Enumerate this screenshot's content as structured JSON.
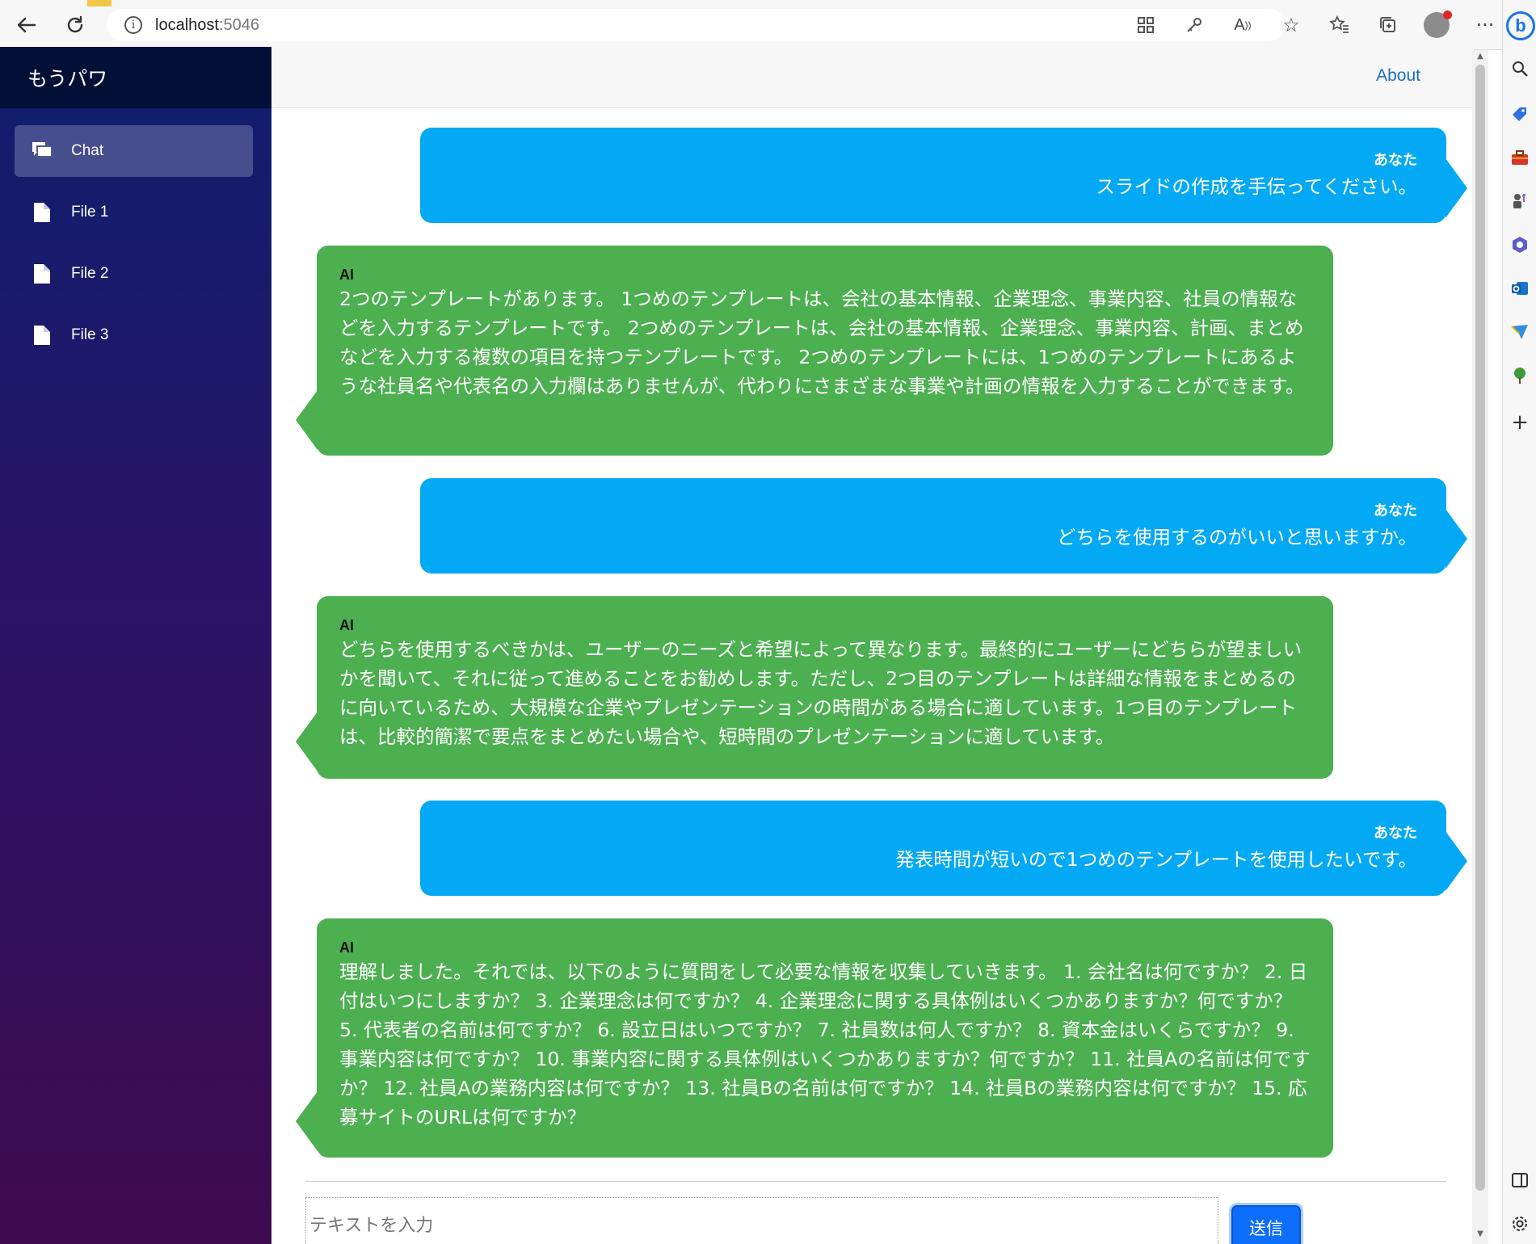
{
  "browser": {
    "url_host": "localhost",
    "url_port": ":5046"
  },
  "app": {
    "brand": "もうパワ",
    "about_label": "About"
  },
  "sidebar": {
    "items": [
      {
        "label": "Chat",
        "icon": "chat-icon",
        "active": true
      },
      {
        "label": "File 1",
        "icon": "file-icon",
        "active": false
      },
      {
        "label": "File 2",
        "icon": "file-icon",
        "active": false
      },
      {
        "label": "File 3",
        "icon": "file-icon",
        "active": false
      }
    ]
  },
  "chat": {
    "messages": [
      {
        "role": "user",
        "sender": "あなた",
        "text": "スライドの作成を手伝ってください。"
      },
      {
        "role": "ai",
        "sender": "AI",
        "text": "2つのテンプレートがあります。 1つめのテンプレートは、会社の基本情報、企業理念、事業内容、社員の情報などを入力するテンプレートです。 2つめのテンプレートは、会社の基本情報、企業理念、事業内容、計画、まとめなどを入力する複数の項目を持つテンプレートです。 2つめのテンプレートには、1つめのテンプレートにあるような社員名や代表名の入力欄はありませんが、代わりにさまざまな事業や計画の情報を入力することができます。"
      },
      {
        "role": "user",
        "sender": "あなた",
        "text": "どちらを使用するのがいいと思いますか。"
      },
      {
        "role": "ai",
        "sender": "AI",
        "text": "どちらを使用するべきかは、ユーザーのニーズと希望によって異なります。最終的にユーザーにどちらが望ましいかを聞いて、それに従って進めることをお勧めします。ただし、2つ目のテンプレートは詳細な情報をまとめるのに向いているため、大規模な企業やプレゼンテーションの時間がある場合に適しています。1つ目のテンプレートは、比較的簡潔で要点をまとめたい場合や、短時間のプレゼンテーションに適しています。"
      },
      {
        "role": "user",
        "sender": "あなた",
        "text": "発表時間が短いので1つめのテンプレートを使用したいです。"
      },
      {
        "role": "ai",
        "sender": "AI",
        "text": "理解しました。それでは、以下のように質問をして必要な情報を収集していきます。 1. 会社名は何ですか？ 2. 日付はいつにしますか？ 3. 企業理念は何ですか？ 4. 企業理念に関する具体例はいくつかありますか？何ですか？ 5. 代表者の名前は何ですか？ 6. 設立日はいつですか？ 7. 社員数は何人ですか？ 8. 資本金はいくらですか？ 9. 事業内容は何ですか？ 10. 事業内容に関する具体例はいくつかありますか？何ですか？ 11. 社員Aの名前は何ですか？ 12. 社員Aの業務内容は何ですか？ 13. 社員Bの名前は何ですか？ 14. 社員Bの業務内容は何ですか？ 15. 応募サイトのURLは何ですか？"
      }
    ]
  },
  "composer": {
    "placeholder": "テキストを入力",
    "value": "",
    "send_label": "送信"
  },
  "colors": {
    "user_bubble": "#03a9f4",
    "ai_bubble": "#4caf50",
    "send_button": "#0d6efd",
    "link": "#1b6ec2"
  }
}
